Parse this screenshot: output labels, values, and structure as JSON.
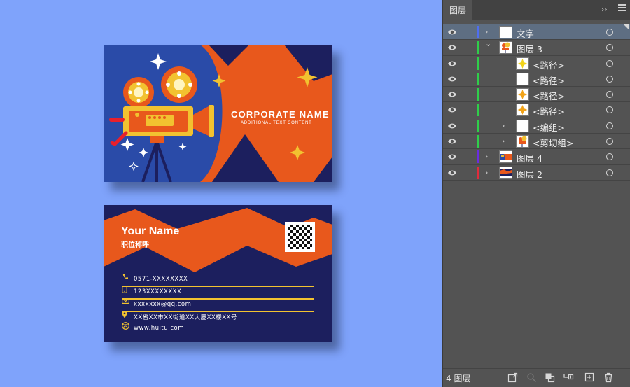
{
  "card_front": {
    "corporate_name": "CORPORATE NAME",
    "additional_text": "ADDITIONAL TEXT CONTENT"
  },
  "card_back": {
    "name": "Your Name",
    "job_title": "职位称呼",
    "contacts": [
      {
        "icon": "phone-icon",
        "text": "0571-XXXXXXXX"
      },
      {
        "icon": "mobile-icon",
        "text": "123XXXXXXXX"
      },
      {
        "icon": "mail-icon",
        "text": "xxxxxxx@qq.com"
      },
      {
        "icon": "location-pin-icon",
        "text": "XX省XX市XX街道XX大厦XX楼XX号"
      },
      {
        "icon": "web-icon",
        "text": "www.huitu.com"
      }
    ]
  },
  "colors": {
    "card_blue": "#2a4ba8",
    "card_navy": "#1c1f5e",
    "card_orange": "#e8581c",
    "gold": "#f2c230",
    "canvas_bg": "#7fa3fb"
  },
  "layers_panel": {
    "tab_label": "图层",
    "layers": [
      {
        "name": "文字",
        "expanded": false,
        "selected": true,
        "color": "#4f6ef0",
        "thumb": "blank"
      },
      {
        "name": "图层 3",
        "expanded": true,
        "selected": false,
        "color": "#2fce4a",
        "thumb": "camera"
      },
      {
        "name": "<路径>",
        "expanded": false,
        "selected": false,
        "color": "#2fce4a",
        "thumb": "star-yellow"
      },
      {
        "name": "<路径>",
        "expanded": false,
        "selected": false,
        "color": "#2fce4a",
        "thumb": "blank"
      },
      {
        "name": "<路径>",
        "expanded": false,
        "selected": false,
        "color": "#2fce4a",
        "thumb": "star-orange"
      },
      {
        "name": "<路径>",
        "expanded": false,
        "selected": false,
        "color": "#2fce4a",
        "thumb": "star-orange"
      },
      {
        "name": "<编组>",
        "expanded": false,
        "selected": false,
        "color": "#2fce4a",
        "thumb": "blank"
      },
      {
        "name": "<剪切组>",
        "expanded": false,
        "selected": false,
        "color": "#2fce4a",
        "thumb": "camera"
      },
      {
        "name": "图层 4",
        "expanded": false,
        "selected": false,
        "color": "#6a2ce0",
        "thumb": "card-front"
      },
      {
        "name": "图层 2",
        "expanded": false,
        "selected": false,
        "color": "#e02c3c",
        "thumb": "card-back"
      }
    ],
    "footer": {
      "layer_count": "4 图层"
    }
  }
}
